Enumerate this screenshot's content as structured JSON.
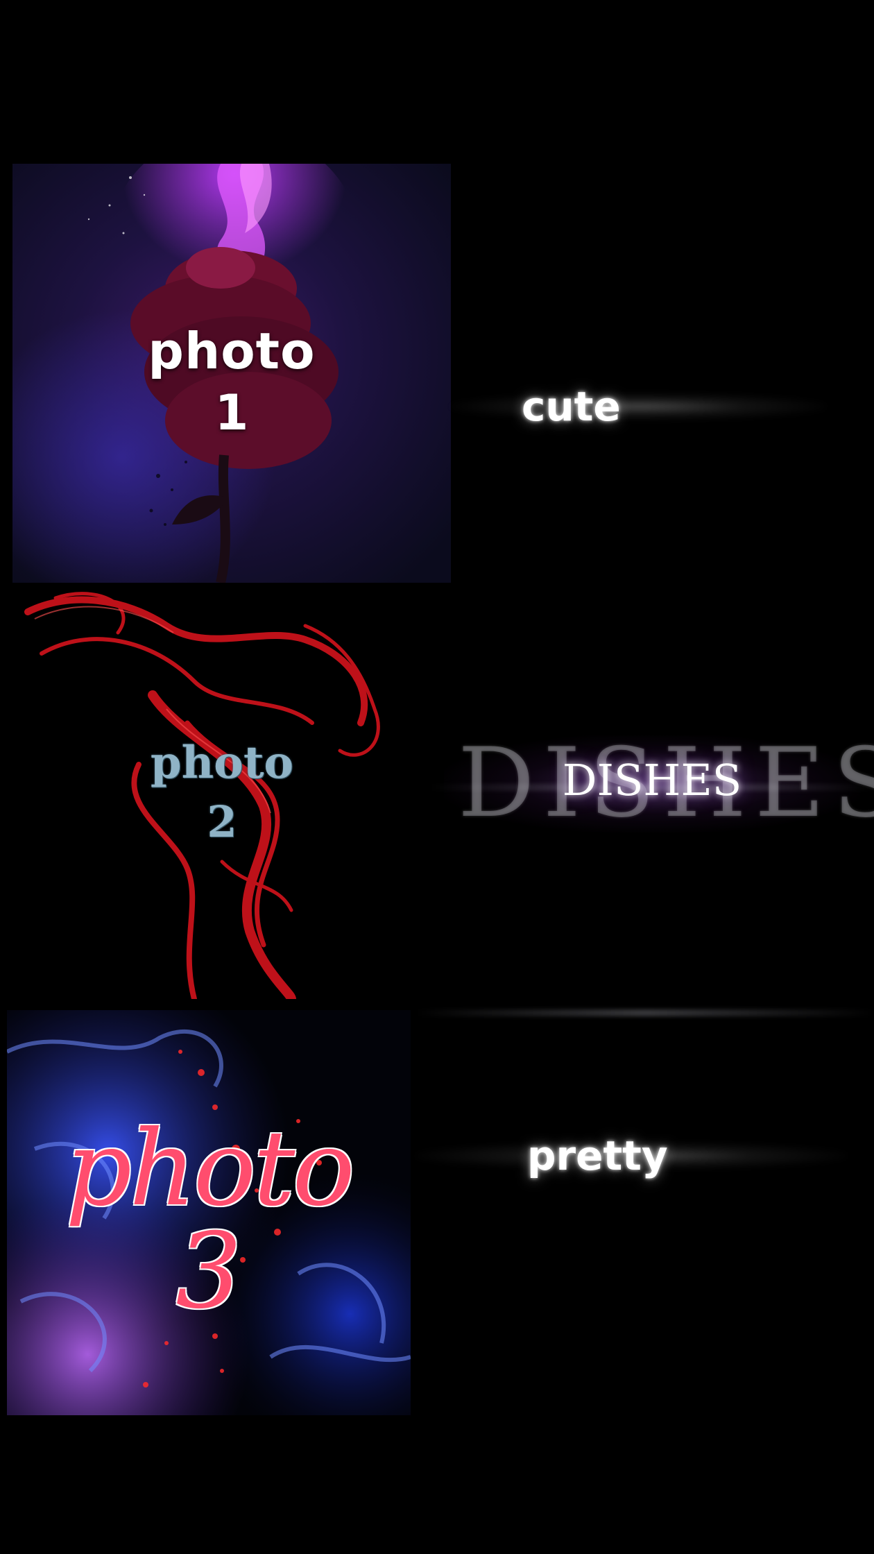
{
  "photos": [
    {
      "line1": "photo",
      "line2": "1"
    },
    {
      "line1": "photo",
      "line2": "2"
    },
    {
      "line1": "photo",
      "line2": "3"
    }
  ],
  "captions": {
    "cute": "cute",
    "dishes_large": "DISHES",
    "dishes_small": "DISHES",
    "pretty": "pretty"
  },
  "colors": {
    "background": "#000000",
    "photo1_accent": "#9b30ff",
    "photo2_smoke": "#e0141e",
    "photo2_text": "#8fb3c6",
    "photo3_text": "#ff4d6e",
    "photo3_smoke": "#2b4bff"
  }
}
